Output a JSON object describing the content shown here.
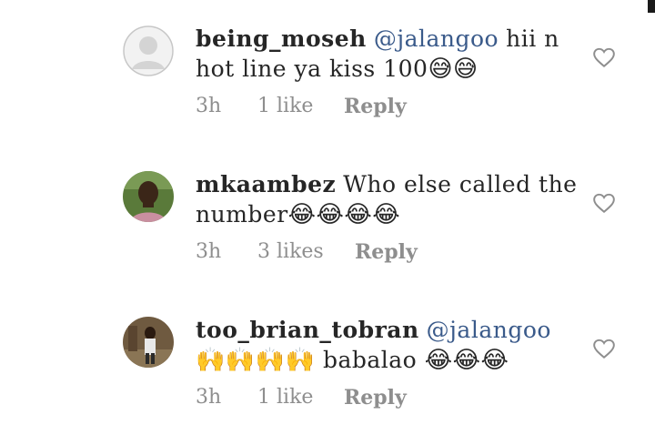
{
  "comments": [
    {
      "username": "being_moseh",
      "mention": "@jalangoo",
      "text": "hii n hot line ya kiss 100",
      "emojis": "😅😅",
      "time": "3h",
      "likes": "1 like",
      "reply": "Reply"
    },
    {
      "username": "mkaambez",
      "mention": "",
      "text": "Who else called the number",
      "emojis": "😂😂😂😂",
      "time": "3h",
      "likes": "3 likes",
      "reply": "Reply"
    },
    {
      "username": "too_brian_tobran",
      "mention": "@jalangoo",
      "text_emojis_lead": "🙌🙌🙌🙌",
      "text": "babalao",
      "emojis": "😂😂😂",
      "time": "3h",
      "likes": "1 like",
      "reply": "Reply"
    }
  ],
  "icons": {
    "like": "heart-outline-icon",
    "default_avatar": "default-avatar-icon"
  },
  "colors": {
    "mention": "#3a5a8a",
    "meta": "#8e8e8e",
    "text": "#262626"
  }
}
